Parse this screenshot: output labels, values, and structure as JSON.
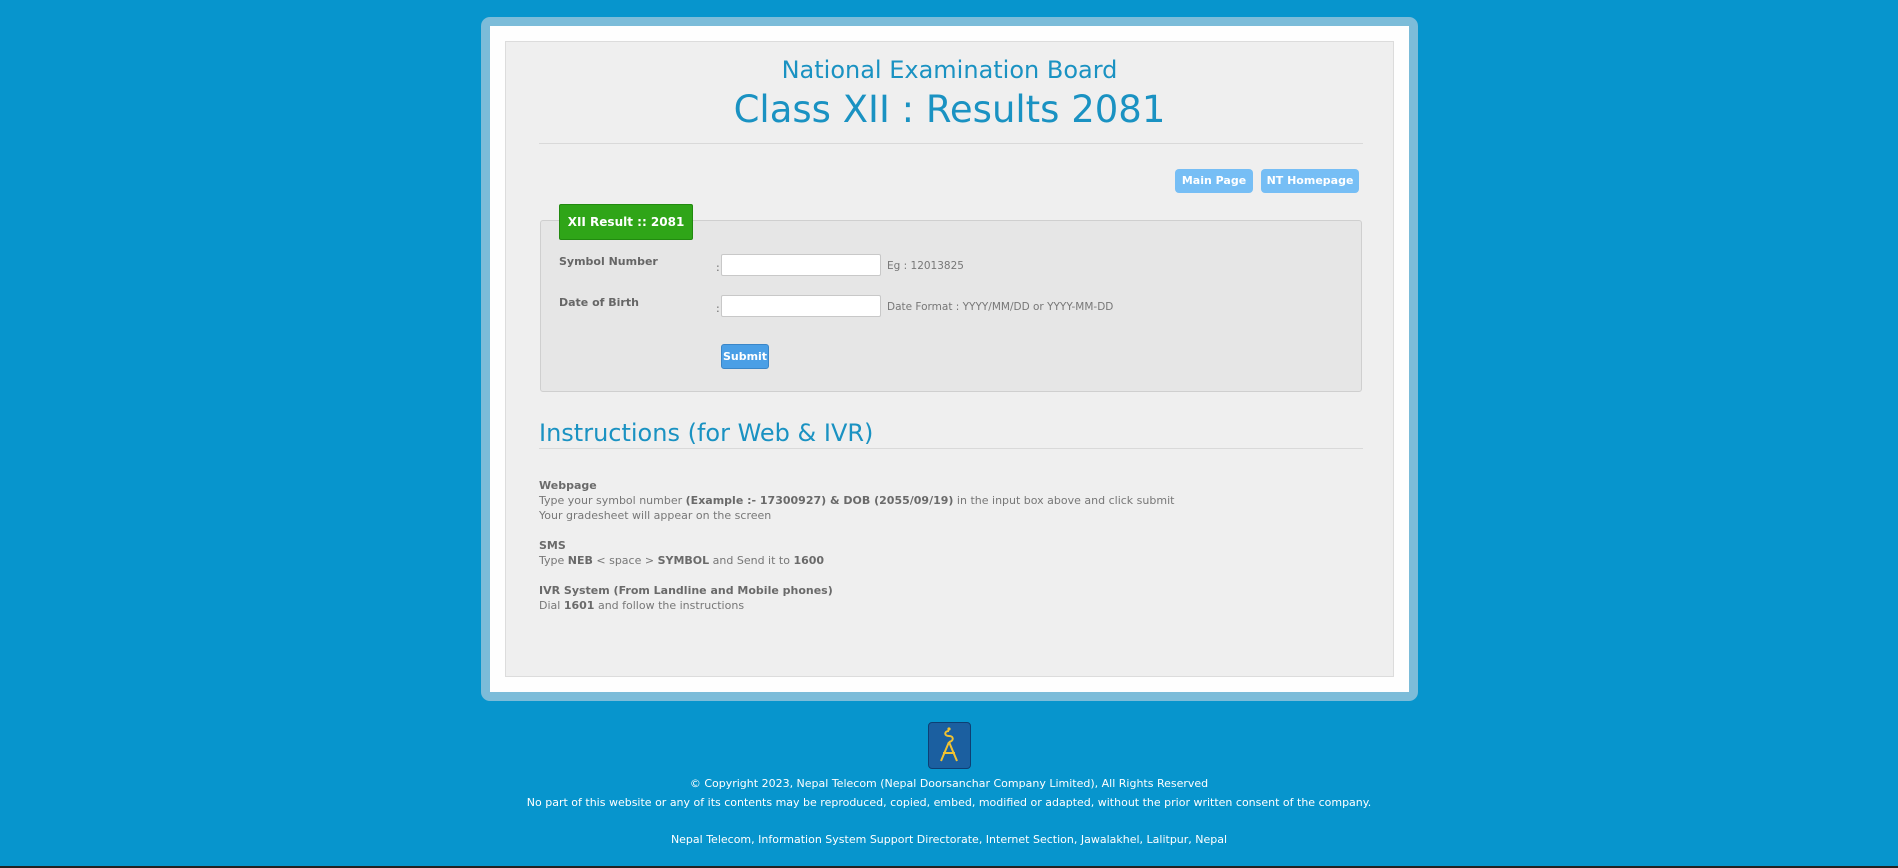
{
  "header": {
    "org": "National Examination Board",
    "title": "Class XII : Results 2081"
  },
  "nav": {
    "main_page": "Main Page",
    "nt_homepage": "NT Homepage"
  },
  "form": {
    "legend": "XII Result :: 2081",
    "symbol_label": "Symbol Number",
    "symbol_value": "",
    "symbol_hint": "Eg : 12013825",
    "dob_label": "Date of Birth",
    "dob_value": "",
    "dob_hint": "Date Format : YYYY/MM/DD or YYYY-MM-DD",
    "colon": ":",
    "submit": "Submit"
  },
  "instructions": {
    "heading": "Instructions (for Web & IVR)",
    "web_title": "Webpage",
    "web_line1_a": "Type your symbol number ",
    "web_line1_b": "(Example :- 17300927) & DOB (2055/09/19)",
    "web_line1_c": " in the input box above and click submit",
    "web_line2": "Your gradesheet will appear on the screen",
    "sms_title": "SMS",
    "sms_a": "Type ",
    "sms_b": "NEB",
    "sms_c": " < space > ",
    "sms_d": "SYMBOL",
    "sms_e": " and Send it to ",
    "sms_f": "1600",
    "ivr_title": "IVR System (From Landline and Mobile phones)",
    "ivr_a": "Dial ",
    "ivr_b": "1601",
    "ivr_c": " and follow the instructions"
  },
  "footer": {
    "copyright": "© Copyright 2023, Nepal Telecom (Nepal Doorsanchar Company Limited), All Rights Reserved",
    "notice": "No part of this website or any of its contents may be reproduced, copied, embed, modified or adapted, without the prior written consent of the company.",
    "address": "Nepal Telecom, Information System Support Directorate, Internet Section, Jawalakhel, Lalitpur, Nepal"
  },
  "colors": {
    "background": "#0795cd",
    "heading": "#1a92c2",
    "legend": "#2fa518",
    "button": "#76bef5",
    "submit": "#4a9fe6"
  },
  "icons": {
    "logo": "nepal-telecom-logo-icon"
  }
}
